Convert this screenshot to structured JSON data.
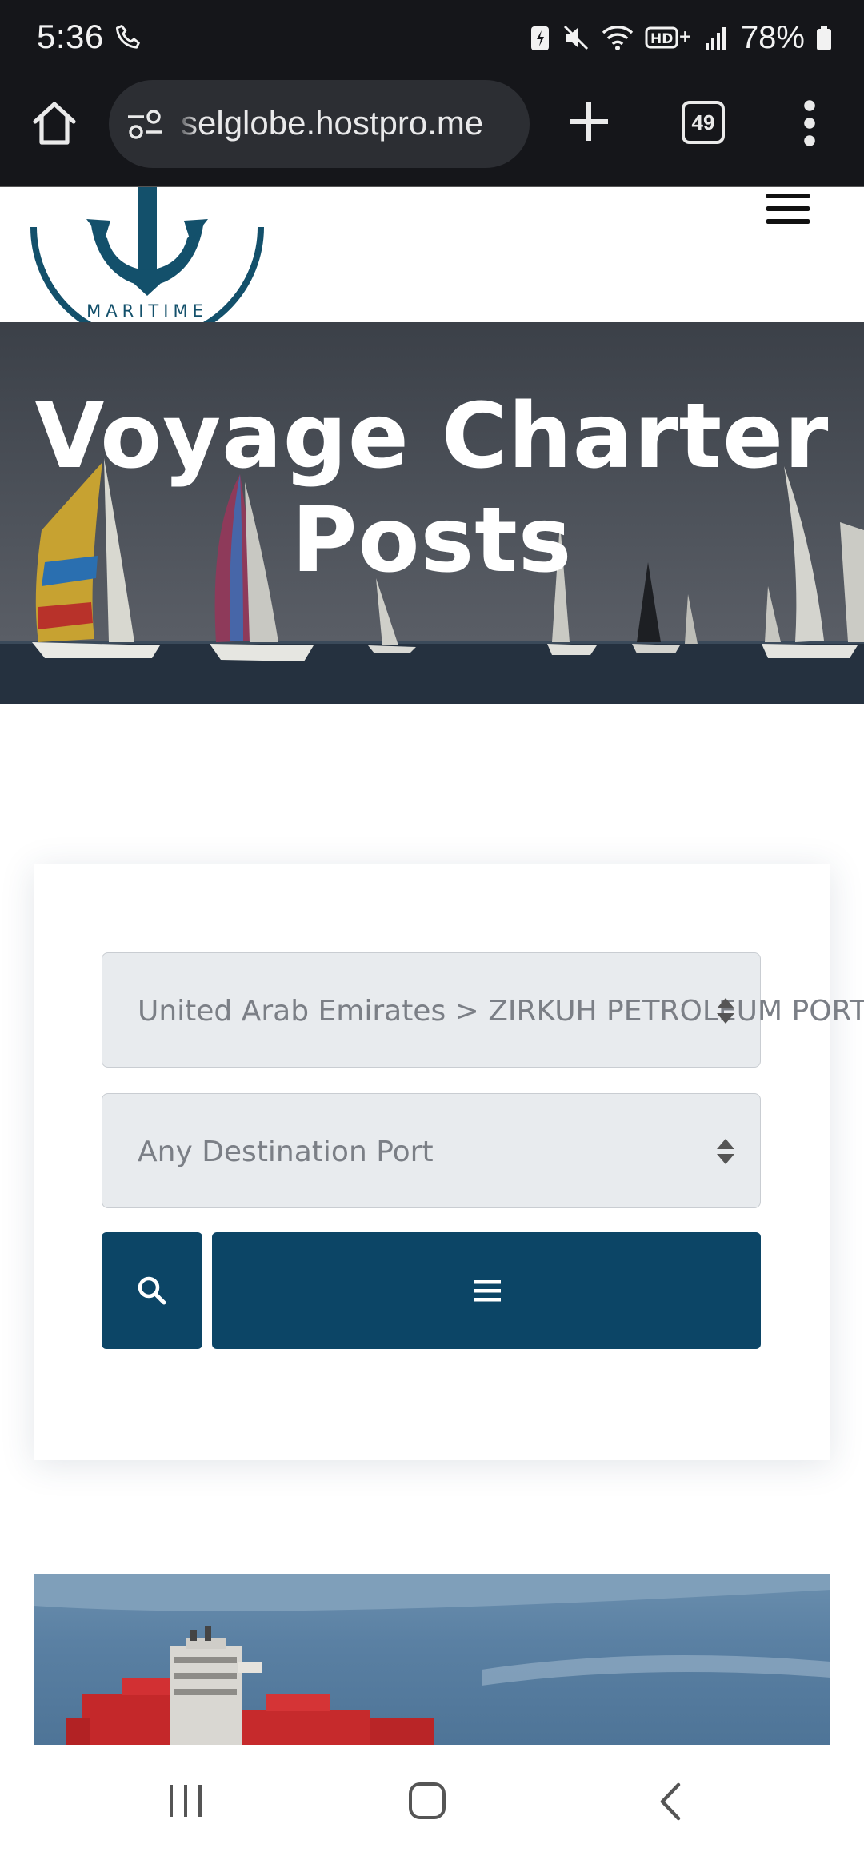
{
  "status_bar": {
    "time": "5:36",
    "battery_percent": "78%"
  },
  "browser": {
    "url": "selglobe.hostpro.me",
    "tab_count": "49"
  },
  "site": {
    "logo_text": "MARITIME"
  },
  "hero": {
    "title_line1": "Voyage Charter",
    "title_line2": "Posts"
  },
  "search": {
    "origin_value": "United Arab Emirates > ZIRKUH PETROLEUM PORT",
    "destination_value": "Any Destination Port"
  },
  "colors": {
    "brand_navy": "#0c4566",
    "logo_teal": "#13506b"
  }
}
